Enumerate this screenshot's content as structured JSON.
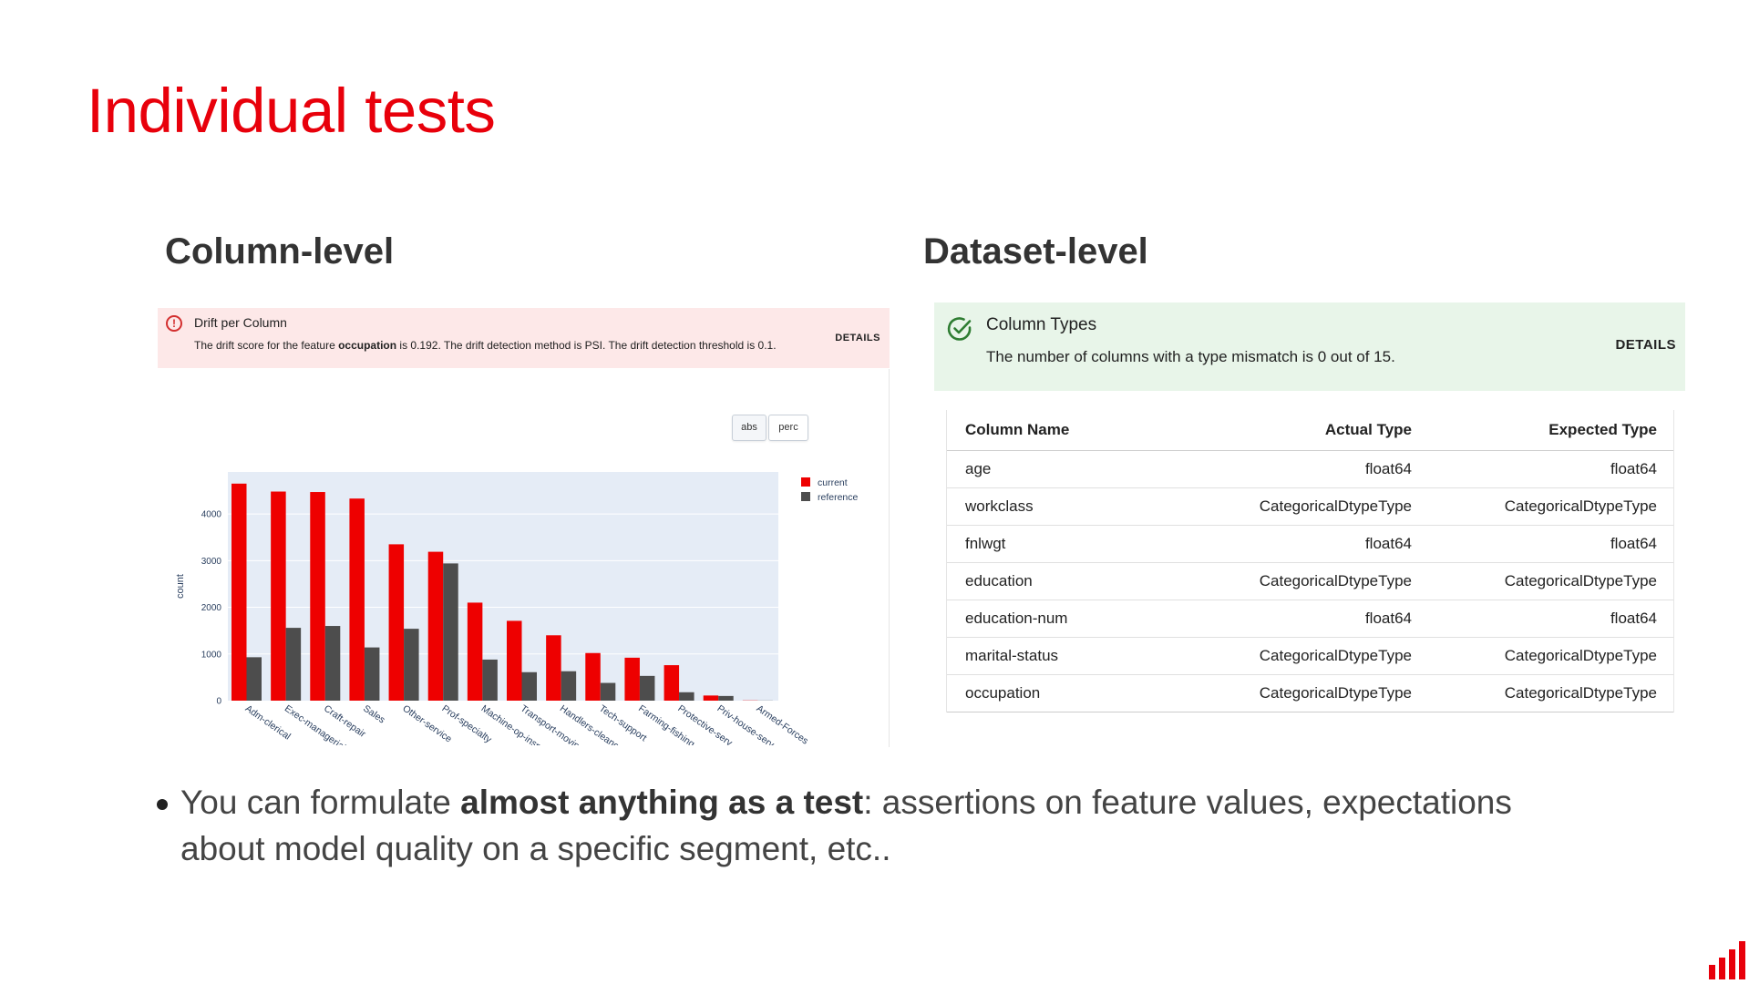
{
  "slide": {
    "title": "Individual tests",
    "column_section_title": "Column-level",
    "dataset_section_title": "Dataset-level"
  },
  "drift_alert": {
    "icon": "alert-circle-icon",
    "title": "Drift per Column",
    "desc_prefix": "The drift score for the feature ",
    "feature": "occupation",
    "desc_suffix": " is 0.192. The drift detection method is PSI. The drift detection threshold is 0.1.",
    "details_label": "DETAILS",
    "status_color": "#d32f2f"
  },
  "chart_toggle": {
    "abs_label": "abs",
    "perc_label": "perc"
  },
  "chart_data": {
    "type": "bar",
    "categories": [
      "Adm-clerical",
      "Exec-managerial",
      "Craft-repair",
      "Sales",
      "Other-service",
      "Prof-specialty",
      "Machine-op-inspct",
      "Transport-moving",
      "Handlers-cleaners",
      "Tech-support",
      "Farming-fishing",
      "Protective-serv",
      "Priv-house-serv",
      "Armed-Forces"
    ],
    "series": [
      {
        "name": "current",
        "color": "#ee0000",
        "values": [
          4650,
          4480,
          4470,
          4330,
          3350,
          3190,
          2100,
          1710,
          1400,
          1020,
          920,
          760,
          110,
          5
        ]
      },
      {
        "name": "reference",
        "color": "#4d4d4d",
        "values": [
          930,
          1560,
          1600,
          1140,
          1540,
          2940,
          880,
          610,
          630,
          380,
          530,
          180,
          100,
          3
        ]
      }
    ],
    "ylabel": "count",
    "xlabel": "",
    "yticks": [
      0,
      1000,
      2000,
      3000,
      4000
    ],
    "ylim": [
      0,
      4900
    ],
    "grid": true,
    "legend_position": "top-right",
    "plot_background": "#e5ecf6"
  },
  "types_alert": {
    "icon": "check-circle-icon",
    "title": "Column Types",
    "desc": "The number of columns with a type mismatch is 0 out of 15.",
    "details_label": "DETAILS",
    "status_color": "#2e7d32"
  },
  "types_table": {
    "headers": [
      "Column Name",
      "Actual Type",
      "Expected Type"
    ],
    "rows": [
      [
        "age",
        "float64",
        "float64"
      ],
      [
        "workclass",
        "CategoricalDtypeType",
        "CategoricalDtypeType"
      ],
      [
        "fnlwgt",
        "float64",
        "float64"
      ],
      [
        "education",
        "CategoricalDtypeType",
        "CategoricalDtypeType"
      ],
      [
        "education-num",
        "float64",
        "float64"
      ],
      [
        "marital-status",
        "CategoricalDtypeType",
        "CategoricalDtypeType"
      ],
      [
        "occupation",
        "CategoricalDtypeType",
        "CategoricalDtypeType"
      ]
    ]
  },
  "bullet": {
    "prefix": "You can formulate ",
    "bold": "almost anything as a test",
    "suffix": ": assertions on feature values, expectations about model quality on a specific segment, etc.."
  },
  "colors": {
    "accent": "#e8000b"
  },
  "logo": {
    "icon": "bar-chart-logo-icon"
  }
}
